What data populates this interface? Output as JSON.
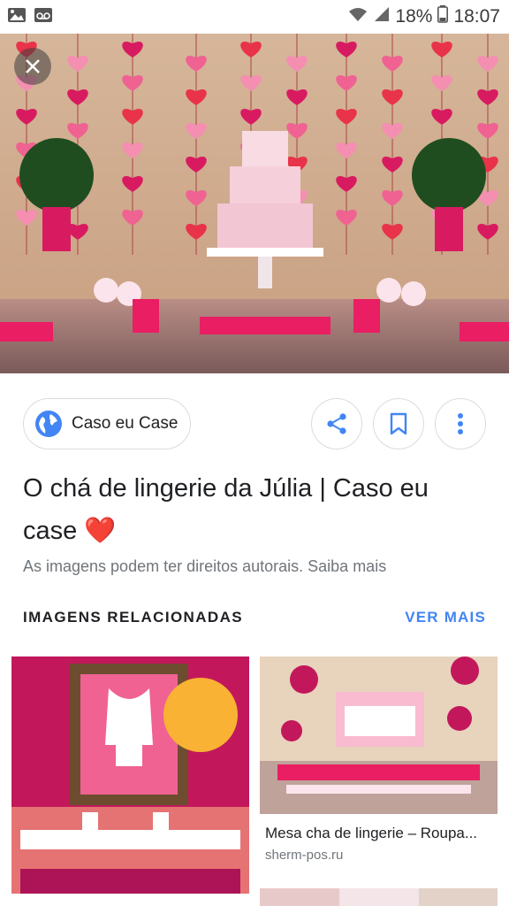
{
  "status_bar": {
    "battery_percent": "18%",
    "time": "18:07",
    "icons": [
      "gallery-icon",
      "voicemail-icon",
      "wifi-icon",
      "signal-icon",
      "battery-icon"
    ]
  },
  "hero": {
    "close_icon": "close-icon"
  },
  "source_chip": {
    "icon": "globe-icon",
    "label": "Caso eu Case"
  },
  "actions": {
    "share_icon": "share-icon",
    "bookmark_icon": "bookmark-icon",
    "more_icon": "more-vert-icon"
  },
  "title": "O chá de lingerie da Júlia | Caso eu case ❤️",
  "copyright_notice": "As imagens podem ter direitos autorais. Saiba mais",
  "related": {
    "header": "IMAGENS RELACIONADAS",
    "see_more": "VER MAIS",
    "items": [
      {
        "caption": "",
        "source": ""
      },
      {
        "caption": "Mesa cha de lingerie – Roupa...",
        "source": "sherm-pos.ru"
      }
    ]
  },
  "colors": {
    "accent_blue": "#4285f4",
    "heart_red": "#e8334a",
    "pink": "#e91e63"
  }
}
